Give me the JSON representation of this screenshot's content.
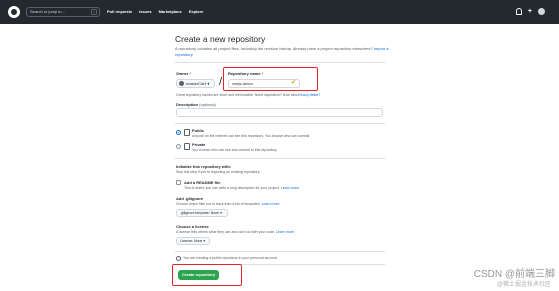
{
  "header": {
    "search_placeholder": "Search or jump to...",
    "search_shortcut": "/",
    "nav": [
      "Pull requests",
      "Issues",
      "Marketplace",
      "Explore"
    ]
  },
  "page": {
    "title": "Create a new repository",
    "subtitle": "A repository contains all project files, including the revision history. Already have a project repository elsewhere?",
    "import_link": "Import a repository."
  },
  "form": {
    "owner_label": "Owner",
    "owner_value": "masterCaH",
    "repo_label": "Repository name",
    "repo_value": "vuejs-demo",
    "required_mark": "*",
    "name_help": "Great repository names are short and memorable. Need inspiration? How about",
    "name_suggestion": "fuzzy-fiesta?",
    "desc_label": "Description",
    "desc_optional": "(optional)",
    "visibility": [
      {
        "label": "Public",
        "help": "Anyone on the internet can see this repository. You choose who can commit.",
        "selected": true
      },
      {
        "label": "Private",
        "help": "You choose who can see and commit to this repository.",
        "selected": false
      }
    ],
    "init_title": "Initialize this repository with:",
    "init_help": "Skip this step if you're importing an existing repository.",
    "readme_label": "Add a README file",
    "readme_help": "This is where you can write a long description for your project.",
    "readme_link": "Learn more.",
    "gitignore_title": "Add .gitignore",
    "gitignore_help": "Choose which files not to track from a list of templates.",
    "gitignore_link": "Learn more.",
    "gitignore_select": ".gitignore template: None",
    "license_title": "Choose a license",
    "license_help": "A license tells others what they can and can't do with your code.",
    "license_link": "Learn more.",
    "license_select": "License: None",
    "notice": "You are creating a public repository in your personal account.",
    "submit": "Create repository"
  },
  "watermark": {
    "main": "CSDN @前端三脚",
    "sub": "@稀土掘金技术社区"
  },
  "colors": {
    "header_bg": "#24292f",
    "primary_button": "#2da44e",
    "highlight_box": "#e5242a",
    "link": "#0969da"
  }
}
